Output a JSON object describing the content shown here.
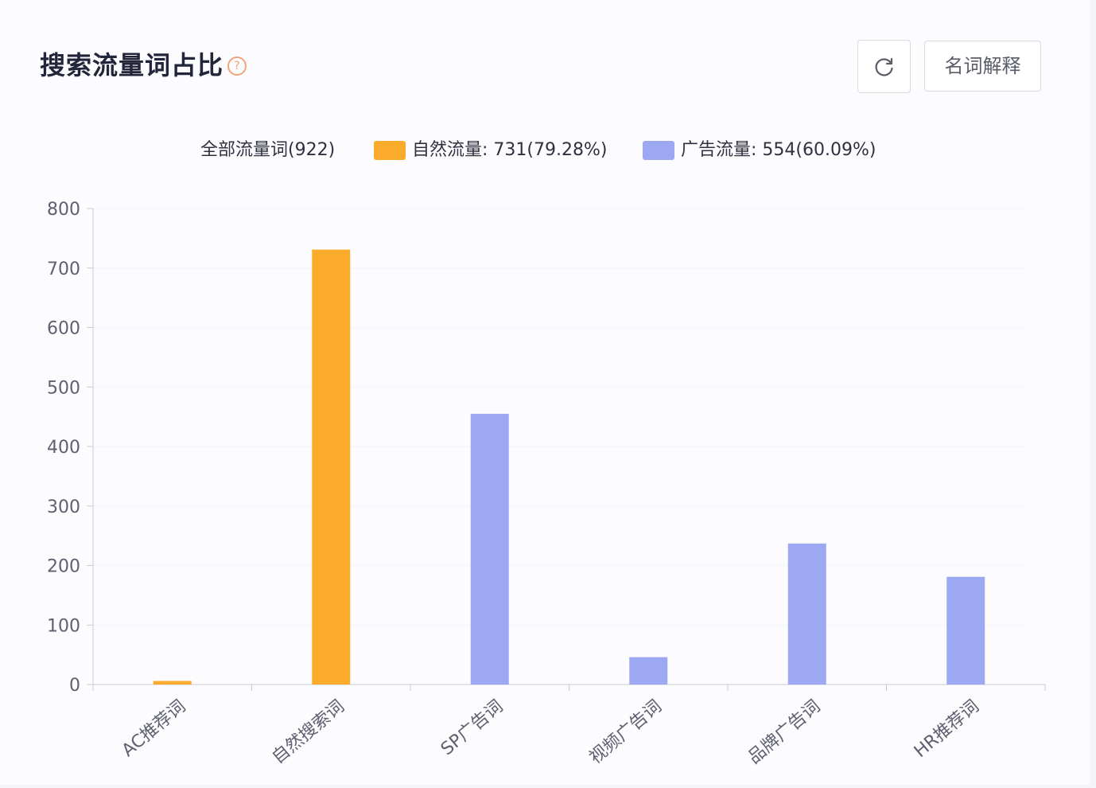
{
  "header": {
    "title": "搜索流量词占比",
    "help_icon": "?",
    "refresh_icon": "refresh-icon",
    "terms_button_label": "名词解释"
  },
  "legend": {
    "all_label": "全部流量词(922)",
    "natural_label": "自然流量: 731(79.28%)",
    "ad_label": "广告流量: 554(60.09%)"
  },
  "colors": {
    "natural": "#fbab2b",
    "ad": "#9da8f3",
    "axis": "#c9ccd6",
    "grid": "#eceef3"
  },
  "chart_data": {
    "type": "bar",
    "categories": [
      "AC推荐词",
      "自然搜索词",
      "SP广告词",
      "视频广告词",
      "品牌广告词",
      "HR推荐词"
    ],
    "series": [
      {
        "name": "自然流量",
        "values": [
          6,
          731,
          null,
          null,
          null,
          null
        ]
      },
      {
        "name": "广告流量",
        "values": [
          null,
          null,
          455,
          46,
          237,
          181
        ]
      }
    ],
    "ylim": [
      0,
      800
    ],
    "yticks": [
      0,
      100,
      200,
      300,
      400,
      500,
      600,
      700,
      800
    ],
    "title": "",
    "xlabel": "",
    "ylabel": "",
    "grid": true,
    "legend_position": "top-center"
  }
}
